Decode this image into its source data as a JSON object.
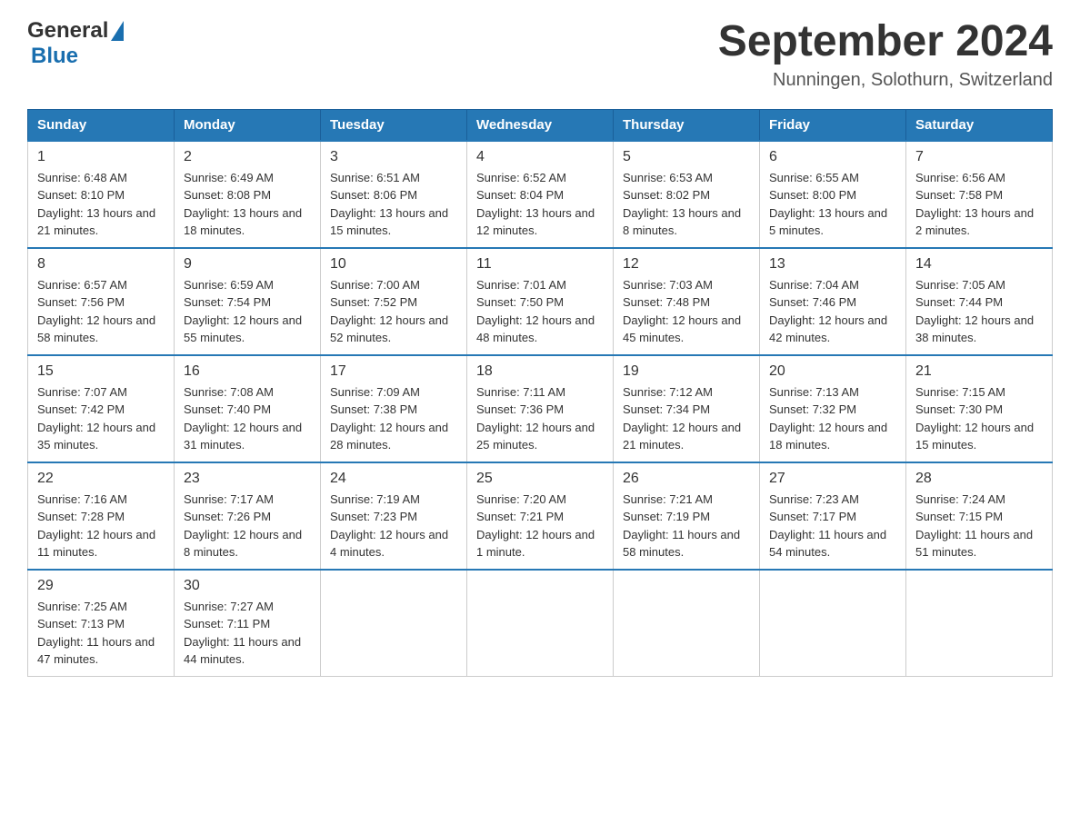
{
  "header": {
    "logo_general": "General",
    "logo_blue": "Blue",
    "title": "September 2024",
    "location": "Nunningen, Solothurn, Switzerland"
  },
  "days_of_week": [
    "Sunday",
    "Monday",
    "Tuesday",
    "Wednesday",
    "Thursday",
    "Friday",
    "Saturday"
  ],
  "weeks": [
    [
      {
        "day": "1",
        "sunrise": "Sunrise: 6:48 AM",
        "sunset": "Sunset: 8:10 PM",
        "daylight": "Daylight: 13 hours and 21 minutes."
      },
      {
        "day": "2",
        "sunrise": "Sunrise: 6:49 AM",
        "sunset": "Sunset: 8:08 PM",
        "daylight": "Daylight: 13 hours and 18 minutes."
      },
      {
        "day": "3",
        "sunrise": "Sunrise: 6:51 AM",
        "sunset": "Sunset: 8:06 PM",
        "daylight": "Daylight: 13 hours and 15 minutes."
      },
      {
        "day": "4",
        "sunrise": "Sunrise: 6:52 AM",
        "sunset": "Sunset: 8:04 PM",
        "daylight": "Daylight: 13 hours and 12 minutes."
      },
      {
        "day": "5",
        "sunrise": "Sunrise: 6:53 AM",
        "sunset": "Sunset: 8:02 PM",
        "daylight": "Daylight: 13 hours and 8 minutes."
      },
      {
        "day": "6",
        "sunrise": "Sunrise: 6:55 AM",
        "sunset": "Sunset: 8:00 PM",
        "daylight": "Daylight: 13 hours and 5 minutes."
      },
      {
        "day": "7",
        "sunrise": "Sunrise: 6:56 AM",
        "sunset": "Sunset: 7:58 PM",
        "daylight": "Daylight: 13 hours and 2 minutes."
      }
    ],
    [
      {
        "day": "8",
        "sunrise": "Sunrise: 6:57 AM",
        "sunset": "Sunset: 7:56 PM",
        "daylight": "Daylight: 12 hours and 58 minutes."
      },
      {
        "day": "9",
        "sunrise": "Sunrise: 6:59 AM",
        "sunset": "Sunset: 7:54 PM",
        "daylight": "Daylight: 12 hours and 55 minutes."
      },
      {
        "day": "10",
        "sunrise": "Sunrise: 7:00 AM",
        "sunset": "Sunset: 7:52 PM",
        "daylight": "Daylight: 12 hours and 52 minutes."
      },
      {
        "day": "11",
        "sunrise": "Sunrise: 7:01 AM",
        "sunset": "Sunset: 7:50 PM",
        "daylight": "Daylight: 12 hours and 48 minutes."
      },
      {
        "day": "12",
        "sunrise": "Sunrise: 7:03 AM",
        "sunset": "Sunset: 7:48 PM",
        "daylight": "Daylight: 12 hours and 45 minutes."
      },
      {
        "day": "13",
        "sunrise": "Sunrise: 7:04 AM",
        "sunset": "Sunset: 7:46 PM",
        "daylight": "Daylight: 12 hours and 42 minutes."
      },
      {
        "day": "14",
        "sunrise": "Sunrise: 7:05 AM",
        "sunset": "Sunset: 7:44 PM",
        "daylight": "Daylight: 12 hours and 38 minutes."
      }
    ],
    [
      {
        "day": "15",
        "sunrise": "Sunrise: 7:07 AM",
        "sunset": "Sunset: 7:42 PM",
        "daylight": "Daylight: 12 hours and 35 minutes."
      },
      {
        "day": "16",
        "sunrise": "Sunrise: 7:08 AM",
        "sunset": "Sunset: 7:40 PM",
        "daylight": "Daylight: 12 hours and 31 minutes."
      },
      {
        "day": "17",
        "sunrise": "Sunrise: 7:09 AM",
        "sunset": "Sunset: 7:38 PM",
        "daylight": "Daylight: 12 hours and 28 minutes."
      },
      {
        "day": "18",
        "sunrise": "Sunrise: 7:11 AM",
        "sunset": "Sunset: 7:36 PM",
        "daylight": "Daylight: 12 hours and 25 minutes."
      },
      {
        "day": "19",
        "sunrise": "Sunrise: 7:12 AM",
        "sunset": "Sunset: 7:34 PM",
        "daylight": "Daylight: 12 hours and 21 minutes."
      },
      {
        "day": "20",
        "sunrise": "Sunrise: 7:13 AM",
        "sunset": "Sunset: 7:32 PM",
        "daylight": "Daylight: 12 hours and 18 minutes."
      },
      {
        "day": "21",
        "sunrise": "Sunrise: 7:15 AM",
        "sunset": "Sunset: 7:30 PM",
        "daylight": "Daylight: 12 hours and 15 minutes."
      }
    ],
    [
      {
        "day": "22",
        "sunrise": "Sunrise: 7:16 AM",
        "sunset": "Sunset: 7:28 PM",
        "daylight": "Daylight: 12 hours and 11 minutes."
      },
      {
        "day": "23",
        "sunrise": "Sunrise: 7:17 AM",
        "sunset": "Sunset: 7:26 PM",
        "daylight": "Daylight: 12 hours and 8 minutes."
      },
      {
        "day": "24",
        "sunrise": "Sunrise: 7:19 AM",
        "sunset": "Sunset: 7:23 PM",
        "daylight": "Daylight: 12 hours and 4 minutes."
      },
      {
        "day": "25",
        "sunrise": "Sunrise: 7:20 AM",
        "sunset": "Sunset: 7:21 PM",
        "daylight": "Daylight: 12 hours and 1 minute."
      },
      {
        "day": "26",
        "sunrise": "Sunrise: 7:21 AM",
        "sunset": "Sunset: 7:19 PM",
        "daylight": "Daylight: 11 hours and 58 minutes."
      },
      {
        "day": "27",
        "sunrise": "Sunrise: 7:23 AM",
        "sunset": "Sunset: 7:17 PM",
        "daylight": "Daylight: 11 hours and 54 minutes."
      },
      {
        "day": "28",
        "sunrise": "Sunrise: 7:24 AM",
        "sunset": "Sunset: 7:15 PM",
        "daylight": "Daylight: 11 hours and 51 minutes."
      }
    ],
    [
      {
        "day": "29",
        "sunrise": "Sunrise: 7:25 AM",
        "sunset": "Sunset: 7:13 PM",
        "daylight": "Daylight: 11 hours and 47 minutes."
      },
      {
        "day": "30",
        "sunrise": "Sunrise: 7:27 AM",
        "sunset": "Sunset: 7:11 PM",
        "daylight": "Daylight: 11 hours and 44 minutes."
      },
      null,
      null,
      null,
      null,
      null
    ]
  ]
}
